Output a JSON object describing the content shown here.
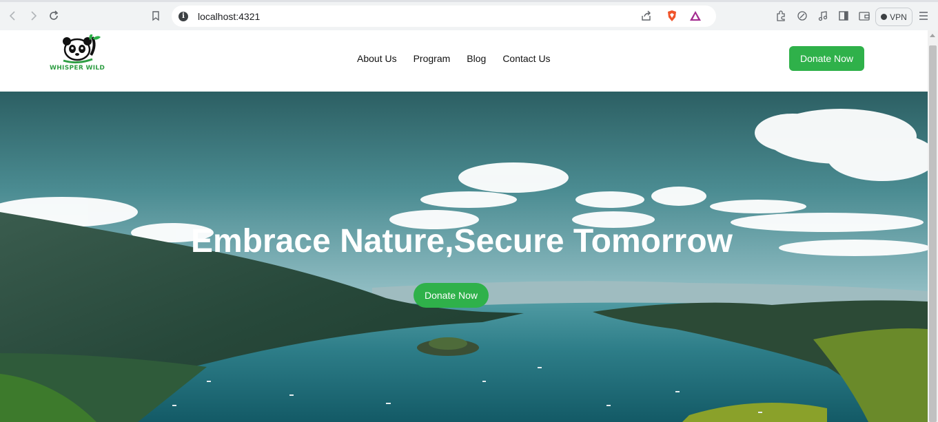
{
  "browser": {
    "url": "localhost:4321",
    "vpn_label": "VPN"
  },
  "site": {
    "logo_text": "WHISPER WILD",
    "nav": [
      "About Us",
      "Program",
      "Blog",
      "Contact Us"
    ],
    "donate_label": "Donate Now"
  },
  "hero": {
    "title": "Embrace Nature,Secure Tomorrow",
    "cta_label": "Donate Now"
  },
  "colors": {
    "accent": "#2fb14a",
    "logo_green": "#2f9e44"
  }
}
